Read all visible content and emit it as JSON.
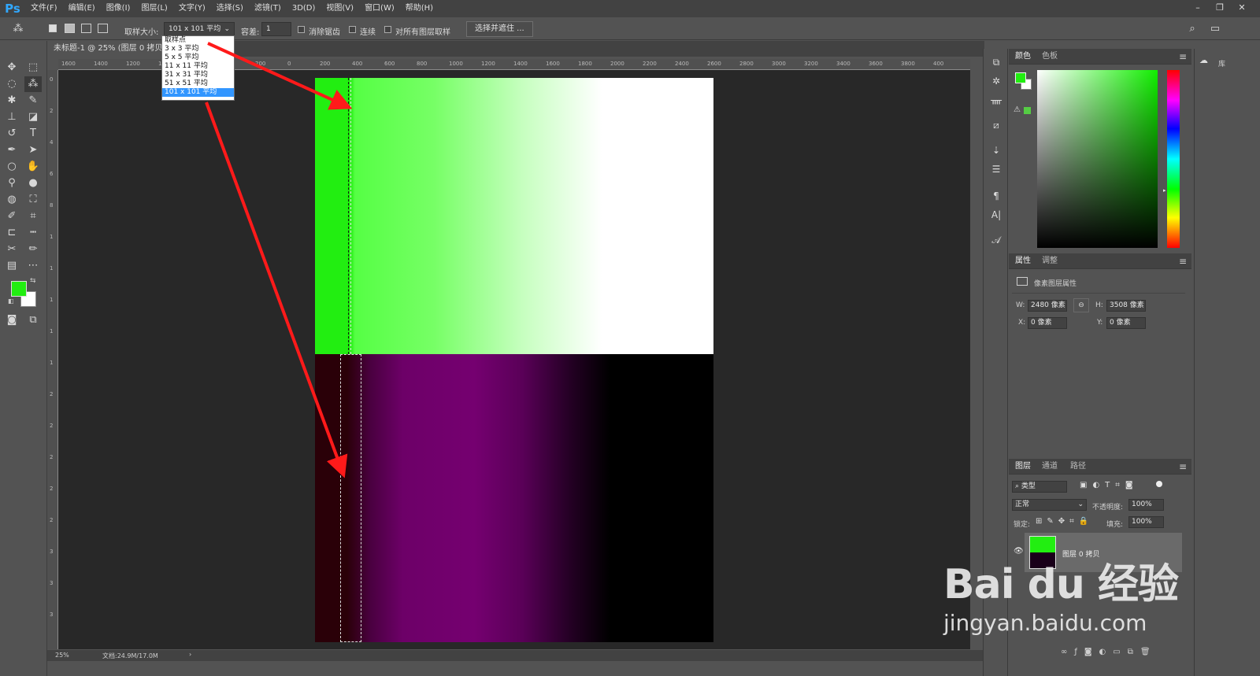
{
  "app": {
    "logo": "Ps"
  },
  "menu": [
    "文件(F)",
    "编辑(E)",
    "图像(I)",
    "图层(L)",
    "文字(Y)",
    "选择(S)",
    "滤镜(T)",
    "3D(D)",
    "视图(V)",
    "窗口(W)",
    "帮助(H)"
  ],
  "options": {
    "sample_label": "取样大小:",
    "sample_value": "101 x 101 平均",
    "tolerance_label": "容差:",
    "tolerance_value": "1",
    "antialias": "消除锯齿",
    "contiguous": "连续",
    "sample_all": "对所有图层取样",
    "select_mask": "选择并遮住 ..."
  },
  "dropdown": {
    "options": [
      "取样点",
      "3 x 3 平均",
      "5 x 5 平均",
      "11 x 11 平均",
      "31 x 31 平均",
      "51 x 51 平均",
      "101 x 101 平均"
    ],
    "selected": "101 x 101 平均"
  },
  "document": {
    "tab_title": "未标题-1 @ 25% (图层 0 拷贝, RGB/8#) *"
  },
  "ruler": {
    "top": [
      "1600",
      "1400",
      "1200",
      "1000",
      "",
      "",
      "200",
      "0",
      "200",
      "400",
      "600",
      "800",
      "1000",
      "1200",
      "1400",
      "1600",
      "1800",
      "2000",
      "2200",
      "2400",
      "2600",
      "2800",
      "3000",
      "3200",
      "3400",
      "3600",
      "3800",
      "400"
    ],
    "left": [
      "0",
      "2",
      "4",
      "6",
      "8",
      "1",
      "1",
      "1",
      "1",
      "1",
      "2",
      "2",
      "2",
      "2",
      "2",
      "3",
      "3",
      "3"
    ]
  },
  "status": {
    "zoom": "25%",
    "doc": "文档:24.9M/17.0M"
  },
  "colors": {
    "accent": "#31a8ff",
    "foreground": "#22ee11",
    "background": "#ffffff",
    "arrow": "#ff1a1a"
  },
  "panels": {
    "color": {
      "tabs": [
        "颜色",
        "色板"
      ]
    },
    "properties": {
      "tabs": [
        "属性",
        "调整"
      ],
      "title": "像素图层属性",
      "w_label": "W:",
      "w_value": "2480 像素",
      "h_label": "H:",
      "h_value": "3508 像素",
      "x_label": "X:",
      "x_value": "0 像素",
      "y_label": "Y:",
      "y_value": "0 像素"
    },
    "layers": {
      "tabs": [
        "图层",
        "通道",
        "路径"
      ],
      "kind": "类型",
      "blend": "正常",
      "opacity_label": "不透明度:",
      "opacity_value": "100%",
      "lock_label": "锁定:",
      "fill_label": "填充:",
      "fill_value": "100%",
      "layer_name": "图层 0 拷贝"
    },
    "library": "库"
  },
  "watermark": {
    "brand": "Bai du 经验",
    "url": "jingyan.baidu.com"
  }
}
